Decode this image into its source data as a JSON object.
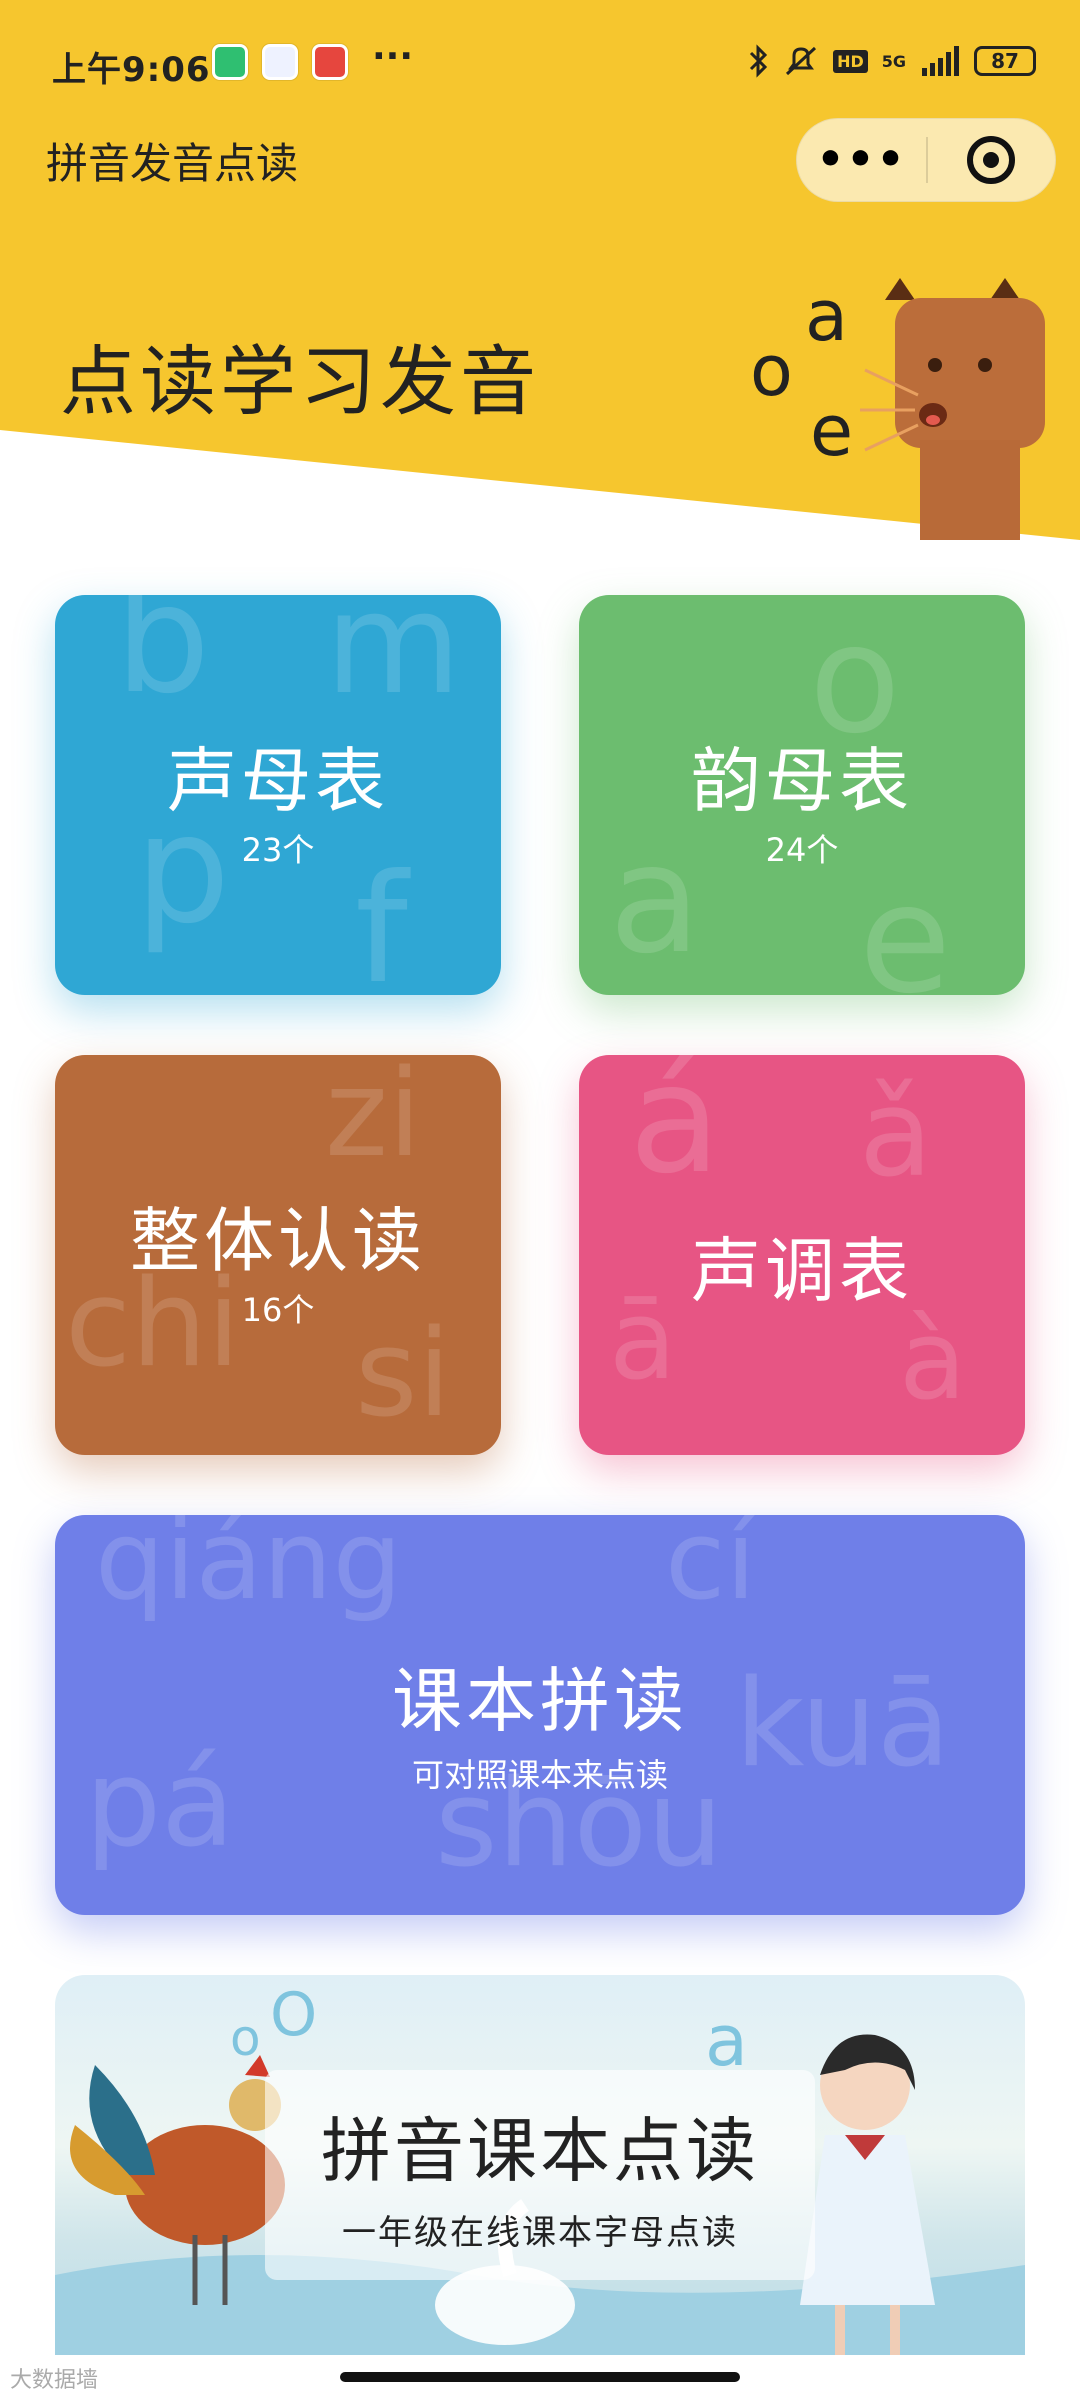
{
  "status_bar": {
    "time": "上午9:06",
    "more": "···",
    "network": "5G",
    "hd": "HD",
    "battery": "87"
  },
  "nav": {
    "title": "拼音发音点读",
    "menu_glyph": "•••"
  },
  "hero": {
    "title": "点读学习发音",
    "mascot_letters": [
      "o",
      "a",
      "e"
    ]
  },
  "cards": [
    {
      "title": "声母表",
      "subtitle": "23个",
      "bg_letters": [
        "b",
        "m",
        "p",
        "f"
      ],
      "color": "#2fa7d4"
    },
    {
      "title": "韵母表",
      "subtitle": "24个",
      "bg_letters": [
        "o",
        "a",
        "e"
      ],
      "color": "#6cbd6f"
    },
    {
      "title": "整体认读",
      "subtitle": "16个",
      "bg_letters": [
        "zi",
        "chi",
        "si"
      ],
      "color": "#b76b3b"
    },
    {
      "title": "声调表",
      "subtitle": "",
      "bg_letters": [
        "á",
        "ǎ",
        "ā",
        "à"
      ],
      "color": "#e75584"
    },
    {
      "title": "课本拼读",
      "subtitle": "可对照课本来点读",
      "bg_letters": [
        "qiáng",
        "cí",
        "pá",
        "shōu",
        "kuā"
      ],
      "color": "#6f7fe8"
    }
  ],
  "banner": {
    "title": "拼音课本点读",
    "subtitle": "一年级在线课本字母点读",
    "deco_letters": [
      "o",
      "O",
      "a"
    ]
  },
  "watermark": "大数据墙"
}
